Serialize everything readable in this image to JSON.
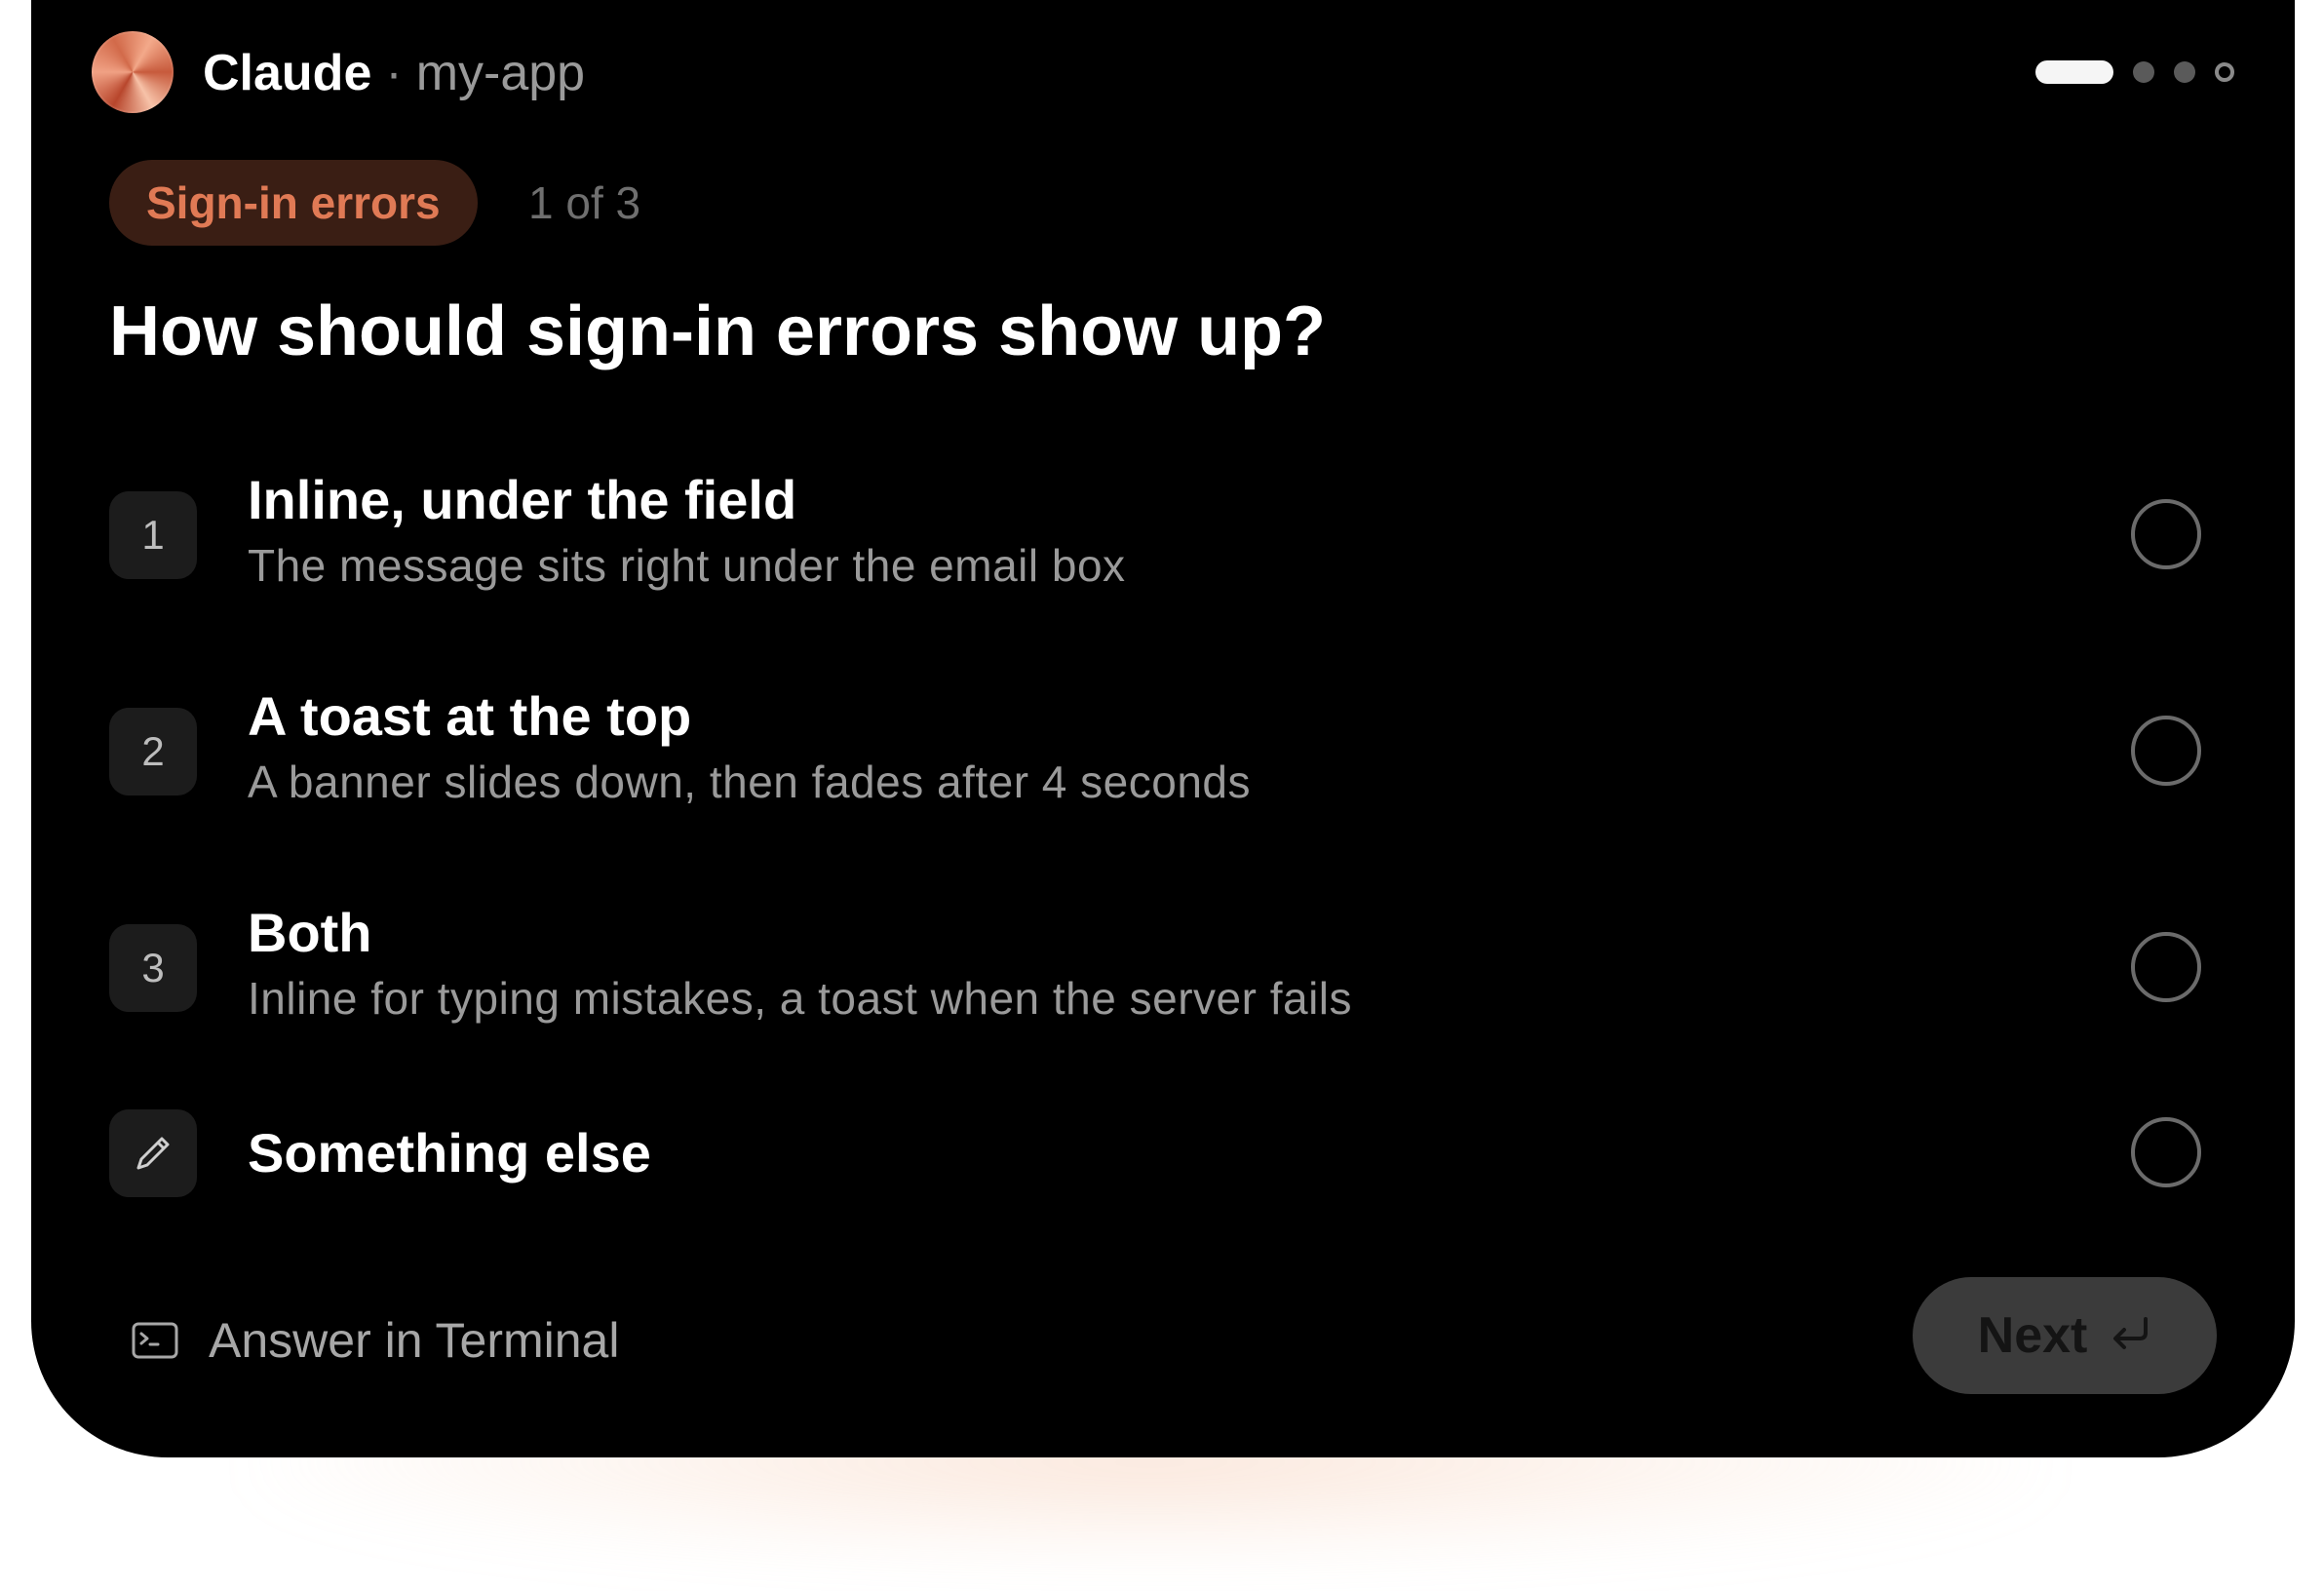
{
  "header": {
    "app_name": "Claude",
    "separator": "·",
    "project": "my-app",
    "steps_total": 4,
    "steps_current": 1
  },
  "category_chip": "Sign-in errors",
  "progress_text": "1 of 3",
  "question": "How should sign-in errors show up?",
  "options": [
    {
      "number": "1",
      "title": "Inline, under the field",
      "description": "The message sits right under the email box"
    },
    {
      "number": "2",
      "title": "A toast at the top",
      "description": "A banner slides down, then fades after 4 seconds"
    },
    {
      "number": "3",
      "title": "Both",
      "description": "Inline for typing mistakes, a toast when the server fails"
    },
    {
      "icon": "pencil-icon",
      "title": "Something else"
    }
  ],
  "footer": {
    "terminal_label": "Answer in Terminal",
    "terminal_icon": "terminal-icon",
    "next_label": "Next",
    "next_icon": "return-icon"
  },
  "colors": {
    "accent": "#e07a55",
    "chip_bg": "#3a1e14",
    "panel_bg": "#000000"
  }
}
